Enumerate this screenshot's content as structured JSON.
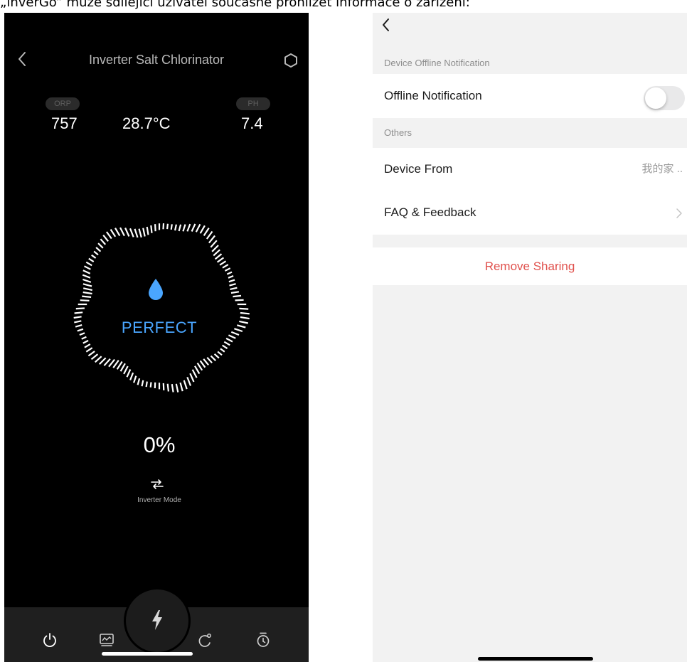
{
  "caption": "„inverGo“ může sdílející uživatel současně prohlížet informace o zařízení:",
  "left_screen": {
    "header": {
      "title": "Inverter Salt Chlorinator"
    },
    "readings": {
      "orp_label": "ORP",
      "orp_value": "757",
      "temperature_value": "28.7°C",
      "ph_label": "PH",
      "ph_value": "7.4"
    },
    "status": {
      "text": "PERFECT",
      "percent": "0%",
      "mode_label": "Inverter Mode"
    },
    "tabbar": {
      "icons": [
        "power-icon",
        "chart-icon",
        "lightning-icon",
        "cycle-icon",
        "timer-icon"
      ]
    },
    "colors": {
      "accent": "#4aa6ff",
      "background": "#000000"
    }
  },
  "right_screen": {
    "section_offline": "Device Offline Notification",
    "offline_notification_label": "Offline Notification",
    "offline_notification_on": false,
    "section_others": "Others",
    "device_from_label": "Device From",
    "device_from_value": "我的家 ..",
    "faq_label": "FAQ & Feedback",
    "remove_sharing_label": "Remove Sharing",
    "colors": {
      "danger": "#e0514d",
      "background": "#f2f2f2"
    }
  }
}
